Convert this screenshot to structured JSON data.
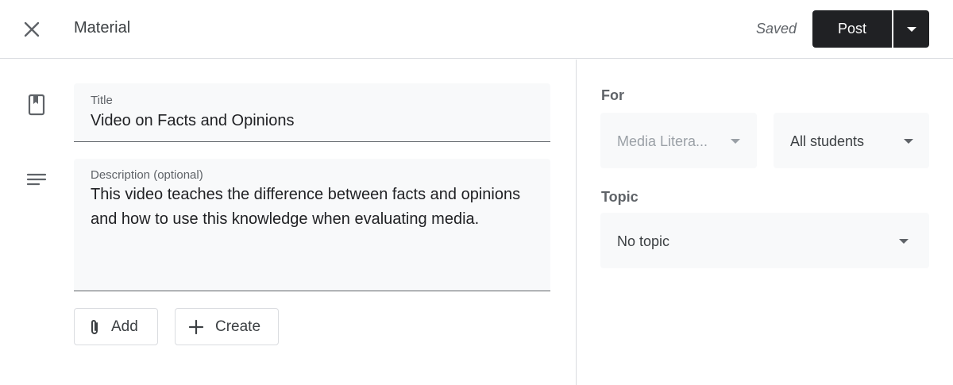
{
  "header": {
    "title": "Material",
    "saved_status": "Saved",
    "post_label": "Post",
    "icons": {
      "close": "close-icon",
      "post_menu": "caret-down-icon"
    }
  },
  "form": {
    "title_field": {
      "label": "Title",
      "value": "Video on Facts and Opinions",
      "icon": "bookmark-icon"
    },
    "description_field": {
      "label": "Description (optional)",
      "value": "This video teaches the difference between facts and opinions and how to use this knowledge when evaluating media.",
      "icon": "notes-icon"
    },
    "actions": {
      "add_label": "Add",
      "create_label": "Create",
      "add_icon": "paperclip-icon",
      "create_icon": "plus-icon"
    }
  },
  "sidebar": {
    "for_label": "For",
    "class_select": "Media Litera...",
    "students_select": "All students",
    "topic_label": "Topic",
    "topic_select": "No topic"
  },
  "colors": {
    "primary_button": "#202124",
    "field_bg": "#f8f9fa",
    "border": "#dadce0",
    "muted_text": "#5f6368"
  }
}
